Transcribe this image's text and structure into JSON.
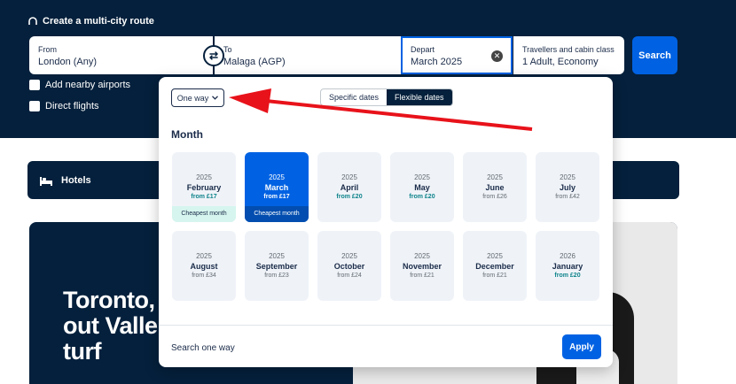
{
  "header": {
    "multicity_link": "Create a multi-city route"
  },
  "search": {
    "from": {
      "label": "From",
      "value": "London (Any)"
    },
    "to": {
      "label": "To",
      "value": "Malaga (AGP)"
    },
    "depart": {
      "label": "Depart",
      "value": "March 2025"
    },
    "travellers": {
      "label": "Travellers and cabin class",
      "value": "1 Adult, Economy"
    },
    "search_button": "Search",
    "swap_icon": "⇄",
    "clear_icon": "✕"
  },
  "options": {
    "nearby_airports": "Add nearby airports",
    "direct_flights": "Direct flights"
  },
  "hotels": {
    "label": "Hotels"
  },
  "promo": {
    "title": "Toronto,\nout Valle\nturf"
  },
  "datepicker": {
    "trip_type": "One way",
    "tabs": {
      "specific": "Specific dates",
      "flexible": "Flexible dates"
    },
    "active_tab": "flexible",
    "section_title": "Month",
    "months": [
      {
        "year": "2025",
        "name": "February",
        "price": "from £17",
        "cheapest": true,
        "tag": "Cheapest month"
      },
      {
        "year": "2025",
        "name": "March",
        "price": "from £17",
        "cheapest": true,
        "tag": "Cheapest month",
        "selected": true
      },
      {
        "year": "2025",
        "name": "April",
        "price": "from £20",
        "cheapest": true
      },
      {
        "year": "2025",
        "name": "May",
        "price": "from £20",
        "cheapest": true
      },
      {
        "year": "2025",
        "name": "June",
        "price": "from £26"
      },
      {
        "year": "2025",
        "name": "July",
        "price": "from £42"
      },
      {
        "year": "2025",
        "name": "August",
        "price": "from £34"
      },
      {
        "year": "2025",
        "name": "September",
        "price": "from £23"
      },
      {
        "year": "2025",
        "name": "October",
        "price": "from £24"
      },
      {
        "year": "2025",
        "name": "November",
        "price": "from £21"
      },
      {
        "year": "2025",
        "name": "December",
        "price": "from £21"
      },
      {
        "year": "2026",
        "name": "January",
        "price": "from £20",
        "cheapest": true
      }
    ],
    "search_one_way": "Search one way",
    "apply_button": "Apply"
  },
  "colors": {
    "brand_dark": "#05203c",
    "accent_blue": "#0062e3",
    "cheap_green": "#0c838a",
    "annotation_red": "#e8121a"
  }
}
